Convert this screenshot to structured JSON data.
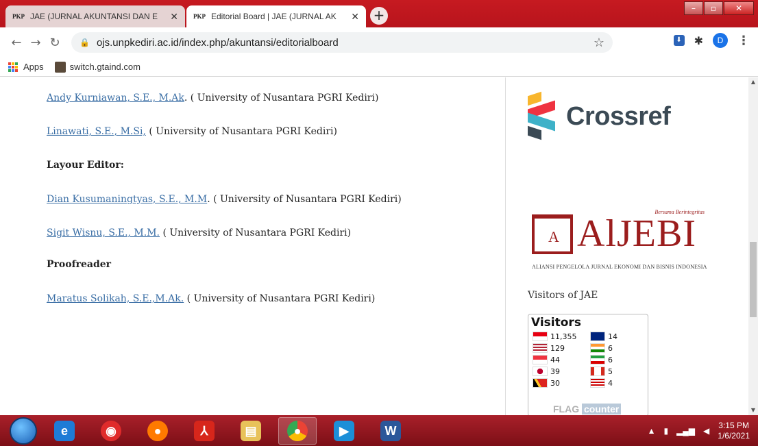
{
  "browser": {
    "tabs": [
      {
        "favicon": "PKP",
        "title": "JAE (JURNAL AKUNTANSI DAN E"
      },
      {
        "favicon": "PKP",
        "title": "Editorial Board | JAE (JURNAL AK"
      }
    ],
    "url": "ojs.unpkediri.ac.id/index.php/akuntansi/editorialboard",
    "profile_initial": "D",
    "bookmarks": [
      {
        "label": "Apps",
        "icon": "apps-grid-icon"
      },
      {
        "label": "switch.gtaind.com",
        "icon": "site-favicon"
      }
    ]
  },
  "content": {
    "entries": [
      {
        "type": "person",
        "name": "Andy Kurniawan, S.E., M.Ak",
        "sep": ". ",
        "affiliation": "( University of  Nusantara PGRI Kediri)"
      },
      {
        "type": "person",
        "name": "Linawati, S.E., M.Si,",
        "sep": " ",
        "affiliation": "( University of  Nusantara PGRI Kediri)"
      },
      {
        "type": "heading",
        "text": "Layour Editor:"
      },
      {
        "type": "person",
        "name": "Dian Kusumaningtyas, S.E., M.M",
        "sep": ". ",
        "affiliation": "( University of  Nusantara PGRI Kediri)"
      },
      {
        "type": "person",
        "name": "Sigit Wisnu, S.E., M.M.",
        "sep": " ",
        "affiliation": "( University of  Nusantara PGRI Kediri)"
      },
      {
        "type": "heading",
        "text": "Proofreader"
      },
      {
        "type": "person",
        "name": "Maratus Solikah, S.E.,M.Ak.",
        "sep": " ",
        "affiliation": "( University of  Nusantara PGRI Kediri)"
      }
    ]
  },
  "sidebar": {
    "crossref_label": "Crossref",
    "aljebi": {
      "brand": "AlJEBI",
      "tagline": "Bersama Berintegritas",
      "subtitle": "ALIANSI PENGELOLA JURNAL EKONOMI DAN BISNIS INDONESIA"
    },
    "visitors_title": "Visitors of JAE",
    "counter": {
      "title": "Visitors",
      "entries": [
        {
          "count": "11,355",
          "flag": "indonesia"
        },
        {
          "count": "14",
          "flag": "australia"
        },
        {
          "count": "129",
          "flag": "united-states"
        },
        {
          "count": "6",
          "flag": "india"
        },
        {
          "count": "44",
          "flag": "singapore"
        },
        {
          "count": "6",
          "flag": "iran"
        },
        {
          "count": "39",
          "flag": "japan"
        },
        {
          "count": "5",
          "flag": "canada"
        },
        {
          "count": "30",
          "flag": "timor-leste"
        },
        {
          "count": "4",
          "flag": "malaysia"
        }
      ],
      "badge_left": "FLAG",
      "badge_right": "counter"
    }
  },
  "taskbar": {
    "apps": [
      "internet-explorer-icon",
      "app-icon",
      "firefox-icon",
      "acrobat-icon",
      "file-explorer-icon",
      "chrome-icon",
      "media-player-icon",
      "word-icon"
    ],
    "time": "3:15 PM",
    "date": "1/6/2021"
  }
}
